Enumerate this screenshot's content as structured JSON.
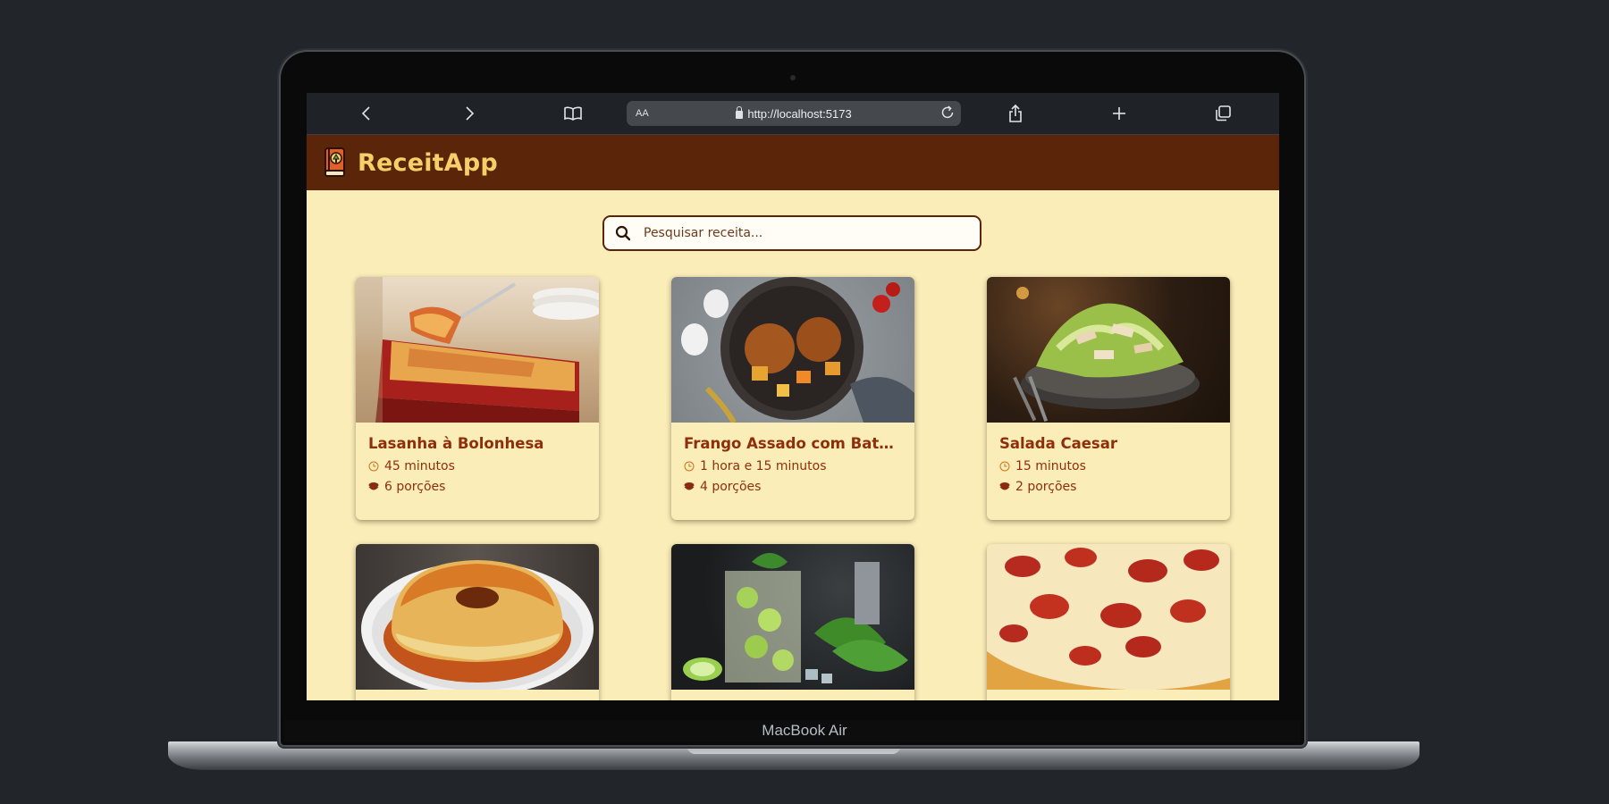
{
  "browser": {
    "aa_label": "AA",
    "url": "http://localhost:5173"
  },
  "device": {
    "brand": "MacBook Air"
  },
  "app": {
    "title": "ReceitApp",
    "accent": "#5a2508",
    "title_color": "#f4cf6a",
    "background": "#faedb8"
  },
  "search": {
    "placeholder": "Pesquisar receita...",
    "value": ""
  },
  "recipes": [
    {
      "title": "Lasanha à Bolonhesa",
      "time": "45 minutos",
      "servings": "6 porções"
    },
    {
      "title": "Frango Assado com Batat…",
      "time": "1 hora e 15 minutos",
      "servings": "4 porções"
    },
    {
      "title": "Salada Caesar",
      "time": "15 minutos",
      "servings": "2 porções"
    },
    {
      "title": "",
      "time": "",
      "servings": ""
    },
    {
      "title": "",
      "time": "",
      "servings": ""
    },
    {
      "title": "",
      "time": "",
      "servings": ""
    }
  ],
  "icons": {
    "back": "chevron-left-icon",
    "forward": "chevron-right-icon",
    "bookmarks": "book-icon",
    "share": "share-icon",
    "new_tab": "plus-icon",
    "tabs": "tabs-icon",
    "reload": "reload-icon",
    "search": "search-icon",
    "time": "clock-icon",
    "servings": "bowl-icon"
  }
}
